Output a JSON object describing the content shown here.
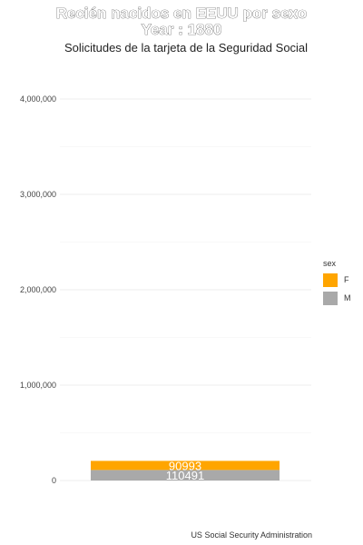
{
  "title_line1": "Recién nacidos en EEUU por sexo",
  "title_line2": "Year : 1880",
  "subtitle": "Solicitudes de la tarjeta de la Seguridad Social",
  "caption": "US Social Security Administration",
  "legend": {
    "title": "sex",
    "items": [
      {
        "label": "F",
        "color": "#FFA500"
      },
      {
        "label": "M",
        "color": "#A9A9A9"
      }
    ]
  },
  "chart_data": {
    "type": "bar",
    "stacked": true,
    "categories": [
      "1880"
    ],
    "series": [
      {
        "name": "M",
        "values": [
          110491
        ],
        "color": "#A9A9A9"
      },
      {
        "name": "F",
        "values": [
          90993
        ],
        "color": "#FFA500"
      }
    ],
    "data_labels": [
      "110491",
      "90993"
    ],
    "ylim": [
      0,
      4000000
    ],
    "y_ticks": [
      0,
      1000000,
      2000000,
      3000000,
      4000000
    ],
    "y_tick_labels": [
      "0",
      "1,000,000",
      "2,000,000",
      "3,000,000",
      "4,000,000"
    ],
    "grid": true,
    "legend_position": "right"
  }
}
